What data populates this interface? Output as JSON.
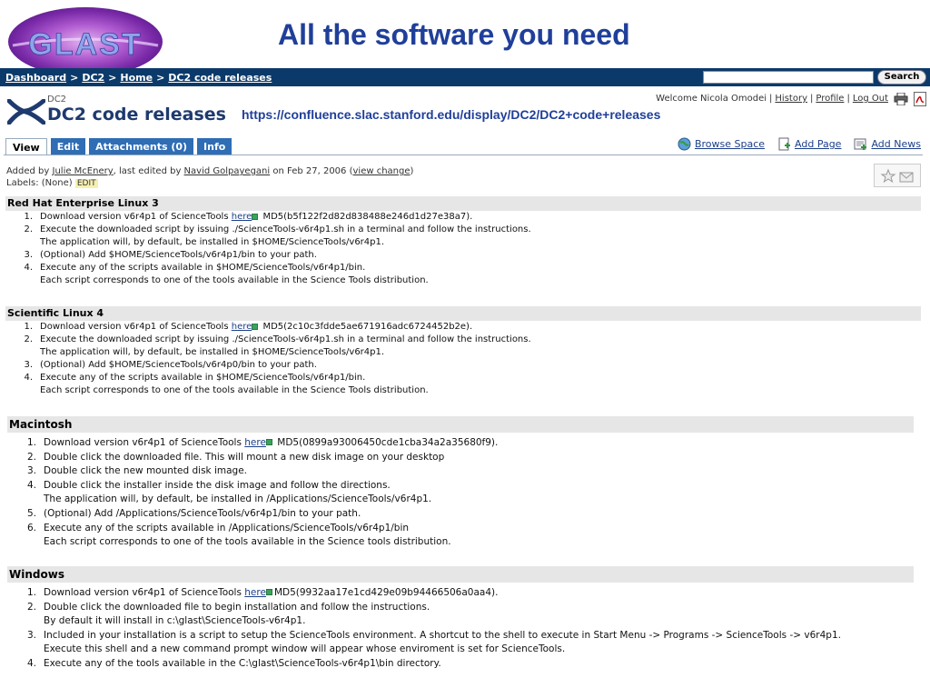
{
  "slide": {
    "logo_text": "GLAST",
    "title": "All the software you need"
  },
  "navbar": {
    "breadcrumbs": [
      "Dashboard",
      "DC2",
      "Home",
      "DC2 code releases"
    ],
    "separator": ">",
    "search_placeholder": "",
    "search_button": "Search"
  },
  "page": {
    "space_name": "DC2",
    "title": "DC2 code releases",
    "url": "https://confluence.slac.stanford.edu/display/DC2/DC2+code+releases"
  },
  "userbar": {
    "welcome": "Welcome Nicola Omodei",
    "links": [
      "History",
      "Profile",
      "Log Out"
    ]
  },
  "tabs": [
    {
      "label": "View",
      "active": true
    },
    {
      "label": "Edit",
      "active": false
    },
    {
      "label": "Attachments (0)",
      "active": false
    },
    {
      "label": "Info",
      "active": false
    }
  ],
  "actions": [
    "Browse Space",
    "Add Page",
    "Add News"
  ],
  "meta": {
    "added_by_prefix": "Added by",
    "added_by": "Julie McEnery",
    "edited_prefix": ", last edited by",
    "edited_by": "Navid Golpayegani",
    "date": "on Feb 27, 2006",
    "view_change": "view change",
    "labels_prefix": "Labels: (None)",
    "labels_edit": "EDIT"
  },
  "sections": {
    "rhel": {
      "heading": "Red Hat Enterprise Linux 3",
      "items": [
        {
          "num": "1.",
          "pre": "Download version v6r4p1 of ScienceTools ",
          "link": "here",
          "post": " MD5(b5f122f2d82d838488e246d1d27e38a7).",
          "extra": ""
        },
        {
          "num": "2.",
          "pre": "Execute the downloaded script by issuing ./ScienceTools-v6r4p1.sh in a terminal and follow the instructions.",
          "link": "",
          "post": "",
          "extra": "The application will, by default, be installed in $HOME/ScienceTools/v6r4p1."
        },
        {
          "num": "3.",
          "pre": "(Optional) Add $HOME/ScienceTools/v6r4p1/bin to your path.",
          "link": "",
          "post": "",
          "extra": ""
        },
        {
          "num": "4.",
          "pre": "Execute any of the scripts available in $HOME/ScienceTools/v6r4p1/bin.",
          "link": "",
          "post": "",
          "extra": "Each script corresponds to one of the tools available in the Science Tools distribution."
        }
      ]
    },
    "sl": {
      "heading": "Scientific Linux 4",
      "items": [
        {
          "num": "1.",
          "pre": "Download version v6r4p1 of ScienceTools ",
          "link": "here",
          "post": " MD5(2c10c3fdde5ae671916adc6724452b2e).",
          "extra": ""
        },
        {
          "num": "2.",
          "pre": "Execute the downloaded script by issuing ./ScienceTools-v6r4p1.sh in a terminal and follow the instructions.",
          "link": "",
          "post": "",
          "extra": "The application will, by default, be installed in $HOME/ScienceTools/v6r4p1."
        },
        {
          "num": "3.",
          "pre": "(Optional) Add $HOME/ScienceTools/v6r4p0/bin to your path.",
          "link": "",
          "post": "",
          "extra": ""
        },
        {
          "num": "4.",
          "pre": "Execute any of the scripts available in $HOME/ScienceTools/v6r4p1/bin.",
          "link": "",
          "post": "",
          "extra": "Each script corresponds to one of the tools available in the Science Tools distribution."
        }
      ]
    },
    "mac": {
      "heading": "Macintosh",
      "items": [
        {
          "num": "1.",
          "pre": "Download version v6r4p1 of ScienceTools ",
          "link": "here",
          "post": " MD5(0899a93006450cde1cba34a2a35680f9).",
          "extra": ""
        },
        {
          "num": "2.",
          "pre": "Double click the downloaded file. This will mount a new disk image on your desktop",
          "link": "",
          "post": "",
          "extra": ""
        },
        {
          "num": "3.",
          "pre": "Double click the new mounted disk image.",
          "link": "",
          "post": "",
          "extra": ""
        },
        {
          "num": "4.",
          "pre": "Double click the installer inside the disk image and follow the directions.",
          "link": "",
          "post": "",
          "extra": "The application will, by default, be installed in /Applications/ScienceTools/v6r4p1."
        },
        {
          "num": "5.",
          "pre": "(Optional) Add /Applications/ScienceTools/v6r4p1/bin to your path.",
          "link": "",
          "post": "",
          "extra": ""
        },
        {
          "num": "6.",
          "pre": "Execute any of the scripts available in /Applications/ScienceTools/v6r4p1/bin",
          "link": "",
          "post": "",
          "extra": "Each script corresponds to one of the tools available in the Science tools distribution."
        }
      ]
    },
    "win": {
      "heading": "Windows",
      "items": [
        {
          "num": "1.",
          "pre": "Download version v6r4p1 of ScienceTools ",
          "link": "here",
          "post": "MD5(9932aa17e1cd429e09b94466506a0aa4).",
          "extra": ""
        },
        {
          "num": "2.",
          "pre": "Double click the downloaded file to begin installation and follow the instructions.",
          "link": "",
          "post": "",
          "extra": "By default it will install in c:\\glast\\ScienceTools-v6r4p1."
        },
        {
          "num": "3.",
          "pre": "Included in your installation is a script to setup the ScienceTools environment.  A shortcut to the shell to execute in Start Menu -> Programs -> ScienceTools -> v6r4p1.",
          "link": "",
          "post": "",
          "extra": "Execute this shell and a new command prompt window will appear whose enviroment is set for ScienceTools."
        },
        {
          "num": "4.",
          "pre": "Execute any of the tools available in the C:\\glast\\ScienceTools-v6r4p1\\bin directory.",
          "link": "",
          "post": "",
          "extra": ""
        }
      ]
    }
  },
  "colors": {
    "navbar_bg": "#0b3a6a",
    "title_blue": "#1f3f9a",
    "tab_blue": "#2f6db5",
    "section_bg": "#e6e6e6",
    "link_blue": "#1c3f8a"
  }
}
